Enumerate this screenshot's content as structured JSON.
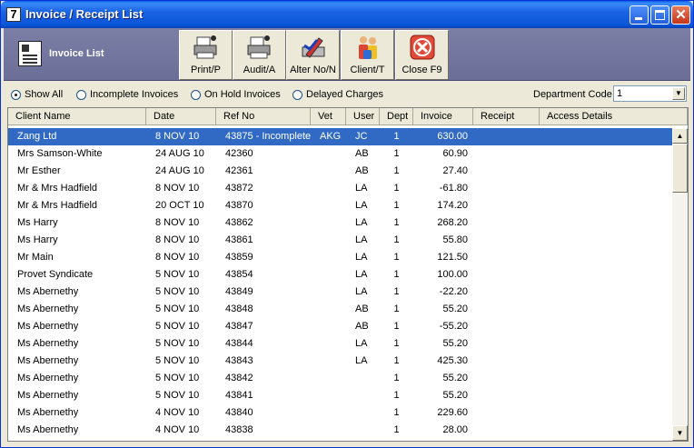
{
  "window": {
    "title": "Invoice / Receipt List",
    "app_icon": "7"
  },
  "toolbar": {
    "list_title": "Invoice List",
    "buttons": [
      {
        "label": "Print/P",
        "icon": "printer-icon"
      },
      {
        "label": "Audit/A",
        "icon": "audit-printer-icon"
      },
      {
        "label": "Alter No/N",
        "icon": "alter-icon"
      },
      {
        "label": "Client/T",
        "icon": "clients-icon"
      },
      {
        "label": "Close F9",
        "icon": "close-icon"
      }
    ]
  },
  "filters": {
    "options": [
      "Show All",
      "Incomplete Invoices",
      "On Hold Invoices",
      "Delayed Charges"
    ],
    "selected": "Show All",
    "department_label": "Department Code",
    "department_value": "1"
  },
  "grid": {
    "columns": [
      "Client Name",
      "Date",
      "Ref No",
      "Vet",
      "User",
      "Dept",
      "Invoice",
      "Receipt",
      "Access Details"
    ],
    "rows": [
      [
        "Zang Ltd",
        "8 NOV 10",
        "43875 - Incomplete",
        "AKG",
        "JC",
        "1",
        "630.00",
        "",
        ""
      ],
      [
        "Mrs Samson-White",
        "24 AUG 10",
        "42360",
        "",
        "AB",
        "1",
        "60.90",
        "",
        ""
      ],
      [
        "Mr Esther",
        "24 AUG 10",
        "42361",
        "",
        "AB",
        "1",
        "27.40",
        "",
        ""
      ],
      [
        "Mr & Mrs Hadfield",
        "8 NOV 10",
        "43872",
        "",
        "LA",
        "1",
        "-61.80",
        "",
        ""
      ],
      [
        "Mr & Mrs Hadfield",
        "20 OCT 10",
        "43870",
        "",
        "LA",
        "1",
        "174.20",
        "",
        ""
      ],
      [
        "Ms Harry",
        "8 NOV 10",
        "43862",
        "",
        "LA",
        "1",
        "268.20",
        "",
        ""
      ],
      [
        "Ms Harry",
        "8 NOV 10",
        "43861",
        "",
        "LA",
        "1",
        "55.80",
        "",
        ""
      ],
      [
        "Mr Main",
        "8 NOV 10",
        "43859",
        "",
        "LA",
        "1",
        "121.50",
        "",
        ""
      ],
      [
        " Provet Syndicate",
        "5 NOV 10",
        "43854",
        "",
        "LA",
        "1",
        "100.00",
        "",
        ""
      ],
      [
        "Ms Abernethy",
        "5 NOV 10",
        "43849",
        "",
        "LA",
        "1",
        "-22.20",
        "",
        ""
      ],
      [
        "Ms Abernethy",
        "5 NOV 10",
        "43848",
        "",
        "AB",
        "1",
        "55.20",
        "",
        ""
      ],
      [
        "Ms Abernethy",
        "5 NOV 10",
        "43847",
        "",
        "AB",
        "1",
        "-55.20",
        "",
        ""
      ],
      [
        "Ms Abernethy",
        "5 NOV 10",
        "43844",
        "",
        "LA",
        "1",
        "55.20",
        "",
        ""
      ],
      [
        "Ms Abernethy",
        "5 NOV 10",
        "43843",
        "",
        "LA",
        "1",
        "425.30",
        "",
        ""
      ],
      [
        "Ms Abernethy",
        "5 NOV 10",
        "43842",
        "",
        "",
        "1",
        "55.20",
        "",
        ""
      ],
      [
        "Ms Abernethy",
        "5 NOV 10",
        "43841",
        "",
        "",
        "1",
        "55.20",
        "",
        ""
      ],
      [
        "Ms Abernethy",
        "4 NOV 10",
        "43840",
        "",
        "",
        "1",
        "229.60",
        "",
        ""
      ],
      [
        "Ms Abernethy",
        "4 NOV 10",
        "43838",
        "",
        "",
        "1",
        "28.00",
        "",
        ""
      ]
    ],
    "selected_row": 0
  },
  "colors": {
    "selection": "#316ac5",
    "titlebar": "#0a56d8",
    "toolbar_band": "#6b6f98"
  }
}
